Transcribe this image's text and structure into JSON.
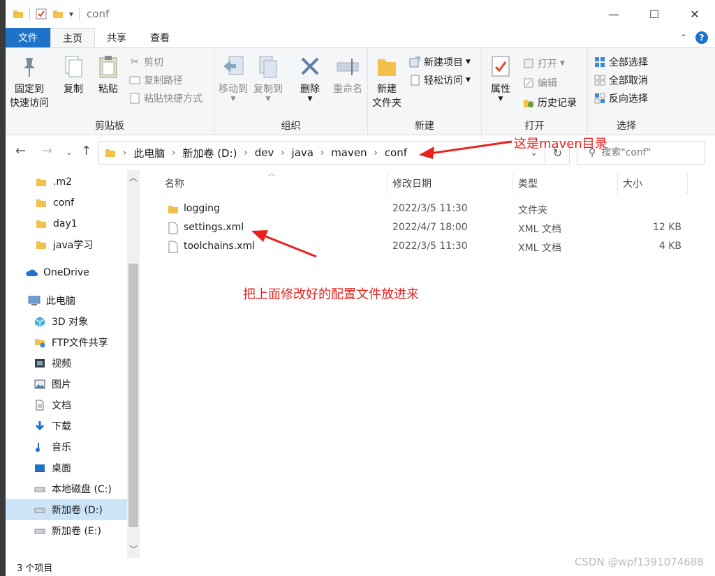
{
  "titlebar": {
    "title": "conf",
    "minimize": "—",
    "maximize": "☐",
    "close": "✕",
    "qa_dropdown": "▾"
  },
  "tabs": [
    {
      "label": "文件"
    },
    {
      "label": "主页"
    },
    {
      "label": "共享"
    },
    {
      "label": "查看"
    }
  ],
  "ribbon": {
    "clipboard": {
      "label": "剪贴板",
      "pin": "固定到",
      "pin2": "快速访问",
      "copy": "复制",
      "paste": "粘贴",
      "cut": "剪切",
      "copy_path": "复制路径",
      "paste_shortcut": "粘贴快捷方式"
    },
    "organize": {
      "label": "组织",
      "move_to": "移动到",
      "copy_to": "复制到",
      "delete": "删除",
      "rename": "重命名"
    },
    "new": {
      "label": "新建",
      "new_folder": "新建",
      "new_folder2": "文件夹",
      "new_item": "新建项目",
      "easy_access": "轻松访问"
    },
    "open": {
      "label": "打开",
      "properties": "属性",
      "open": "打开",
      "edit": "编辑",
      "history": "历史记录"
    },
    "select": {
      "label": "选择",
      "select_all": "全部选择",
      "select_none": "全部取消",
      "invert": "反向选择"
    }
  },
  "address": {
    "crumbs": [
      "此电脑",
      "新加卷 (D:)",
      "dev",
      "java",
      "maven",
      "conf"
    ],
    "search_placeholder": "搜索\"conf\""
  },
  "sidebar": {
    "items": [
      {
        "label": ".m2",
        "icon": "folder-icon"
      },
      {
        "label": "conf",
        "icon": "folder-icon"
      },
      {
        "label": "day1",
        "icon": "folder-icon"
      },
      {
        "label": "java学习",
        "icon": "folder-icon"
      },
      {
        "label": "OneDrive",
        "icon": "cloud-icon"
      },
      {
        "label": "此电脑",
        "icon": "computer-icon"
      },
      {
        "label": "3D 对象",
        "icon": "cube-icon"
      },
      {
        "label": "FTP文件共享",
        "icon": "network-folder-icon"
      },
      {
        "label": "视频",
        "icon": "video-icon"
      },
      {
        "label": "图片",
        "icon": "picture-icon"
      },
      {
        "label": "文档",
        "icon": "document-icon"
      },
      {
        "label": "下载",
        "icon": "download-icon"
      },
      {
        "label": "音乐",
        "icon": "music-icon"
      },
      {
        "label": "桌面",
        "icon": "desktop-icon"
      },
      {
        "label": "本地磁盘 (C:)",
        "icon": "drive-icon"
      },
      {
        "label": "新加卷 (D:)",
        "icon": "drive-icon"
      },
      {
        "label": "新加卷 (E:)",
        "icon": "drive-icon"
      }
    ]
  },
  "columns": {
    "name": "名称",
    "modified": "修改日期",
    "type": "类型",
    "size": "大小"
  },
  "files": [
    {
      "name": "logging",
      "modified": "2022/3/5 11:30",
      "type": "文件夹",
      "size": ""
    },
    {
      "name": "settings.xml",
      "modified": "2022/4/7 18:00",
      "type": "XML 文档",
      "size": "12 KB"
    },
    {
      "name": "toolchains.xml",
      "modified": "2022/3/5 11:30",
      "type": "XML 文档",
      "size": "4 KB"
    }
  ],
  "status": {
    "count": "3 个项目"
  },
  "watermark": "CSDN @wpf1391074688",
  "annotations": {
    "maven_dir": "这是maven目录",
    "put_config": "把上面修改好的配置文件放进来"
  },
  "colors": {
    "accent": "#1e73c8",
    "annotation": "#e8231f",
    "selected": "#cce4f7"
  }
}
